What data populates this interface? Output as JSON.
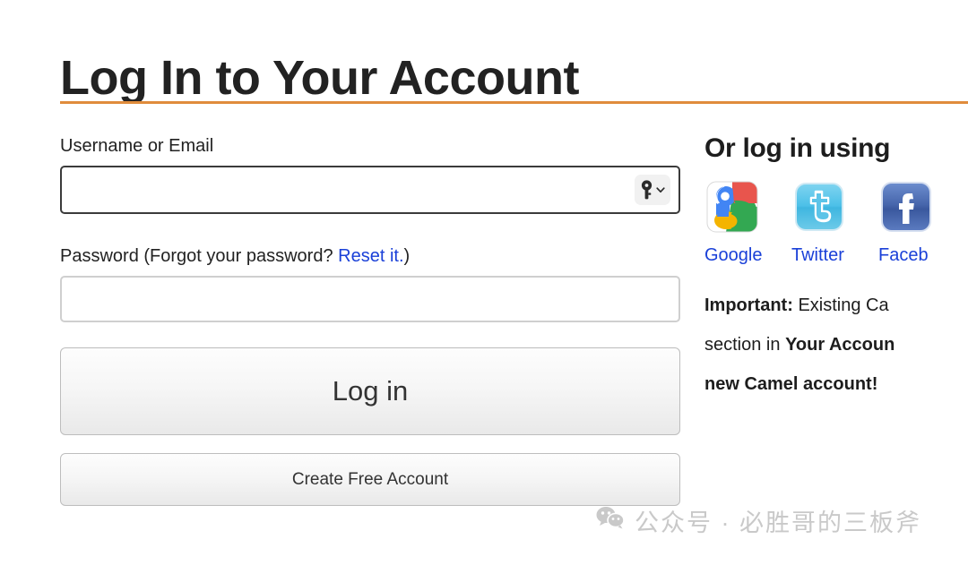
{
  "page": {
    "title": "Log In to Your Account",
    "accent_color": "#e08c3c",
    "link_color": "#1a40d8"
  },
  "form": {
    "username": {
      "label": "Username or Email",
      "value": "",
      "placeholder": "",
      "key_icon": "key-icon",
      "chevron_icon": "chevron-down-icon"
    },
    "password": {
      "label_prefix": "Password (Forgot your password? ",
      "label_link": "Reset it.",
      "label_suffix": ")",
      "value": "",
      "placeholder": ""
    },
    "login_button": "Log in",
    "create_account_button": "Create Free Account"
  },
  "social": {
    "heading": "Or log in using",
    "providers": [
      {
        "name": "Google",
        "label": "Google",
        "icon": "google-icon"
      },
      {
        "name": "Twitter",
        "label": "Twitter",
        "icon": "twitter-icon"
      },
      {
        "name": "Facebook",
        "label": "Faceb",
        "icon": "facebook-icon"
      }
    ]
  },
  "notice": {
    "lead": "Important:",
    "line1_rest": " Existing Ca",
    "line2_plain_a": "section in ",
    "line2_bold": "Your Accoun",
    "line3_bold": "new Camel account!"
  },
  "watermark": {
    "icon": "wechat-icon",
    "text": "公众号 · 必胜哥的三板斧"
  }
}
